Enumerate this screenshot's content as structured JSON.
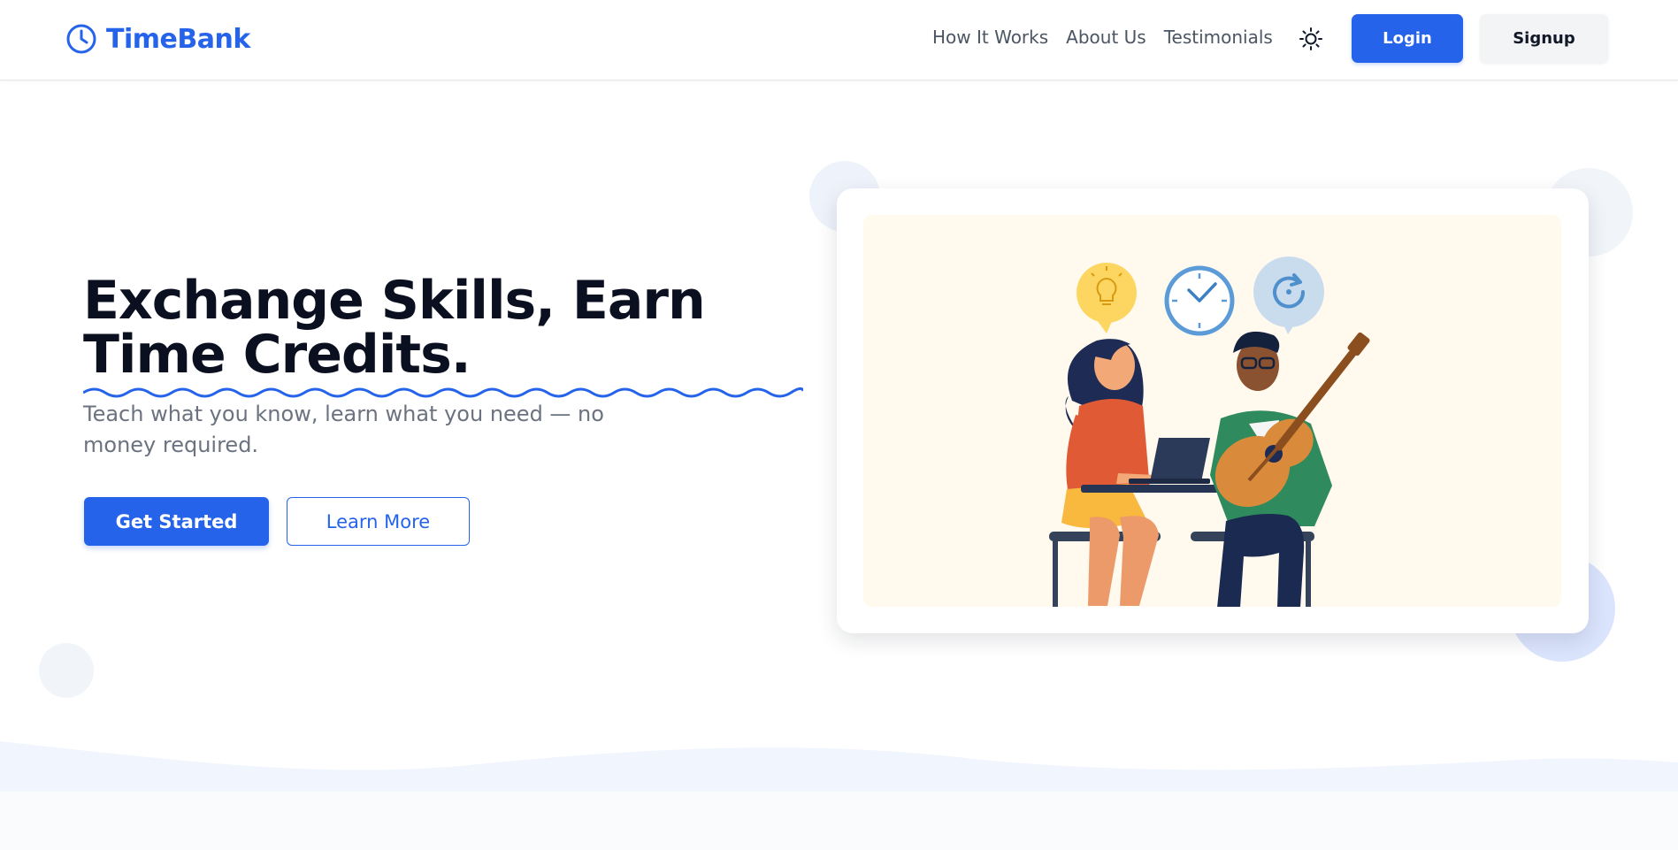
{
  "navbar": {
    "brand": "TimeBank",
    "links": [
      "How It Works",
      "About Us",
      "Testimonials"
    ],
    "theme_toggle_icon": "sun-icon",
    "login_label": "Login",
    "signup_label": "Signup"
  },
  "hero": {
    "title_line1": "Exchange Skills, Earn",
    "title_line2": "Time Credits.",
    "subtitle": "Teach what you know, learn what you need — no money required.",
    "primary_cta": "Get Started",
    "secondary_cta": "Learn More",
    "illustration_icons": [
      "lightbulb-icon",
      "clock-icon",
      "refresh-icon"
    ]
  },
  "colors": {
    "primary": "#2563eb",
    "heading": "#0b1020",
    "muted_text": "#6b7280",
    "illustration_bg": "#fff9ee"
  }
}
